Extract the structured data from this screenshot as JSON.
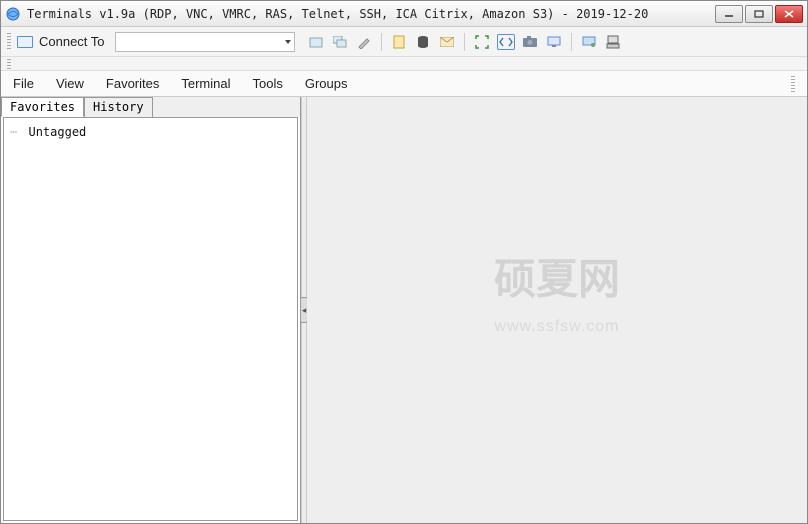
{
  "window": {
    "title": "Terminals v1.9a (RDP, VNC, VMRC, RAS, Telnet, SSH, ICA Citrix, Amazon S3) - 2019-12-20"
  },
  "toolbar": {
    "connect_label": "Connect To",
    "combo_value": ""
  },
  "menu": {
    "file": "File",
    "view": "View",
    "favorites": "Favorites",
    "terminal": "Terminal",
    "tools": "Tools",
    "groups": "Groups"
  },
  "sidebar": {
    "tabs": [
      {
        "label": "Favorites",
        "active": true
      },
      {
        "label": "History",
        "active": false
      }
    ],
    "tree": [
      {
        "label": "Untagged"
      }
    ]
  },
  "watermark": {
    "main": "硕夏网",
    "sub": "www.ssfsw.com"
  }
}
